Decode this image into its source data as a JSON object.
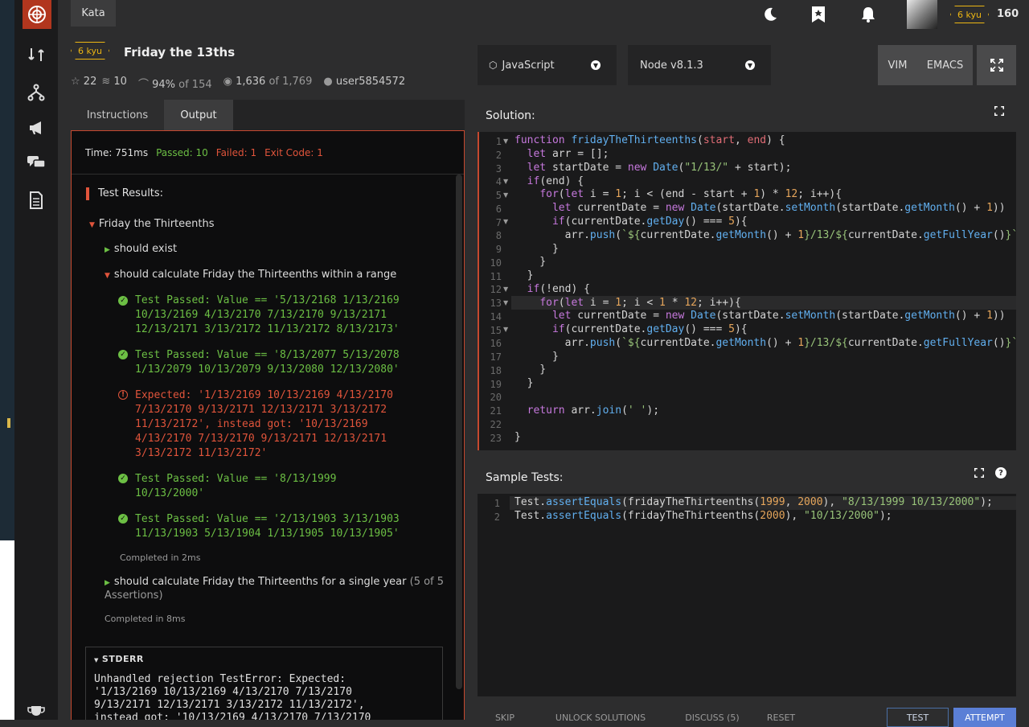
{
  "topbar": {
    "kata_label": "Kata",
    "honor": "160",
    "rank_badge": "6 kyu"
  },
  "kata": {
    "rank": "6 kyu",
    "title": "Friday the 13ths",
    "stats": {
      "stars": "22",
      "collections": "10",
      "satisfaction": "94%",
      "satisfaction_of": "of 154",
      "completed": "1,636",
      "completed_of": "of 1,769",
      "author": "user5854572"
    }
  },
  "tabs": {
    "instructions": "Instructions",
    "output": "Output"
  },
  "output": {
    "time": "Time: 751ms",
    "passed": "Passed: 10",
    "failed": "Failed: 1",
    "exit_code": "Exit Code: 1",
    "results_label": "Test Results:",
    "suite": "Friday the Thirteenths",
    "should_exist": "should exist",
    "range_group": "should calculate Friday the Thirteenths within a range",
    "results": [
      "Test Passed: Value == '5/13/2168 1/13/2169\n10/13/2169 4/13/2170 7/13/2170 9/13/2171\n12/13/2171 3/13/2172 11/13/2172 8/13/2173'",
      "Test Passed: Value == '8/13/2077 5/13/2078\n1/13/2079 10/13/2079 9/13/2080 12/13/2080'",
      "Expected: '1/13/2169 10/13/2169 4/13/2170\n7/13/2170 9/13/2171 12/13/2171 3/13/2172\n11/13/2172', instead got: '10/13/2169\n4/13/2170 7/13/2170 9/13/2171 12/13/2171\n3/13/2172 11/13/2172'",
      "Test Passed: Value == '8/13/1999\n10/13/2000'",
      "Test Passed: Value == '2/13/1903 3/13/1903\n11/13/1903 5/13/1904 1/13/1905 10/13/1905'"
    ],
    "completed_range": "Completed in 2ms",
    "single_year_group": "should calculate Friday the Thirteenths for a single year",
    "single_year_assertions": "(5 of 5",
    "single_year_assertions2": "Assertions)",
    "completed_single": "Completed in 8ms",
    "stderr_label": "STDERR",
    "stderr_text": "Unhandled rejection TestError: Expected:\n'1/13/2169 10/13/2169 4/13/2170 7/13/2170\n9/13/2171 12/13/2171 3/13/2172 11/13/2172',\ninstead got: '10/13/2169 4/13/2170 7/13/2170"
  },
  "toolbar": {
    "language": "JavaScript",
    "version": "Node v8.1.3",
    "vim": "VIM",
    "emacs": "EMACS"
  },
  "solution": {
    "title": "Solution:",
    "line_numbers": [
      "1",
      "2",
      "3",
      "4",
      "5",
      "6",
      "7",
      "8",
      "9",
      "10",
      "11",
      "12",
      "13",
      "14",
      "15",
      "16",
      "17",
      "18",
      "19",
      "20",
      "21",
      "22",
      "23"
    ]
  },
  "sample_tests": {
    "title": "Sample Tests:",
    "line_numbers": [
      "1",
      "2"
    ]
  },
  "bottom": {
    "skip": "SKIP",
    "unlock": "UNLOCK SOLUTIONS",
    "discuss": "DISCUSS (5)",
    "reset": "RESET",
    "test": "TEST",
    "attempt": "ATTEMPT"
  }
}
